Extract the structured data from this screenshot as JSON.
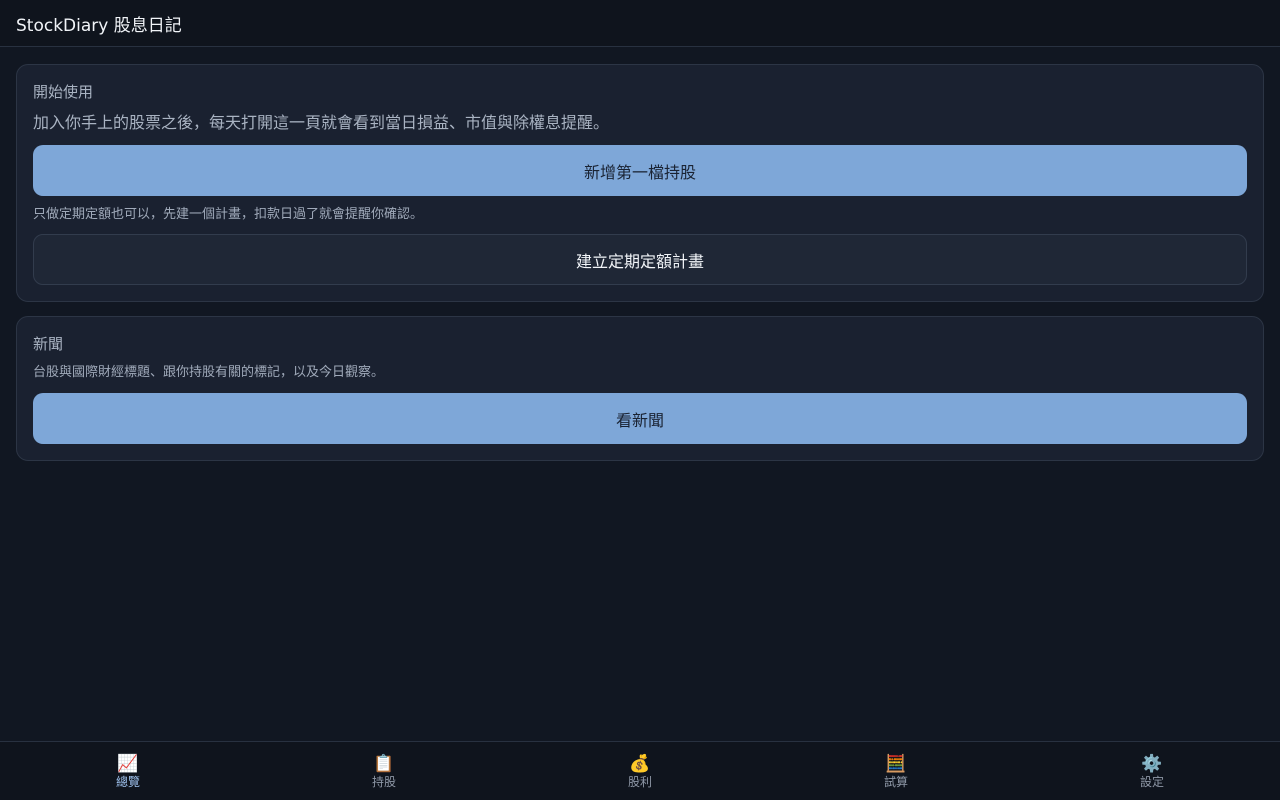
{
  "app": {
    "title": "StockDiary 股息日記"
  },
  "getting_started": {
    "title": "開始使用",
    "lead": "加入你手上的股票之後，每天打開這一頁就會看到當日損益、市值與除權息提醒。",
    "add_holding_label": "新增第一檔持股",
    "dca_hint": "只做定期定額也可以，先建一個計畫，扣款日過了就會提醒你確認。",
    "create_dca_label": "建立定期定額計畫"
  },
  "news": {
    "title": "新聞",
    "description": "台股與國際財經標題、跟你持股有關的標記，以及今日觀察。",
    "view_news_label": "看新聞"
  },
  "nav": {
    "items": [
      {
        "icon": "📈",
        "icon_name": "chart-increasing-icon",
        "label": "總覽",
        "active": true
      },
      {
        "icon": "📋",
        "icon_name": "clipboard-icon",
        "label": "持股",
        "active": false
      },
      {
        "icon": "💰",
        "icon_name": "money-bag-icon",
        "label": "股利",
        "active": false
      },
      {
        "icon": "🧮",
        "icon_name": "abacus-icon",
        "label": "試算",
        "active": false
      },
      {
        "icon": "⚙️",
        "icon_name": "gear-icon",
        "label": "設定",
        "active": false
      }
    ]
  },
  "colors": {
    "background": "#111722",
    "card": "#1a2130",
    "primary_button": "#7ea7d8",
    "active_nav": "#9fc2ee"
  }
}
